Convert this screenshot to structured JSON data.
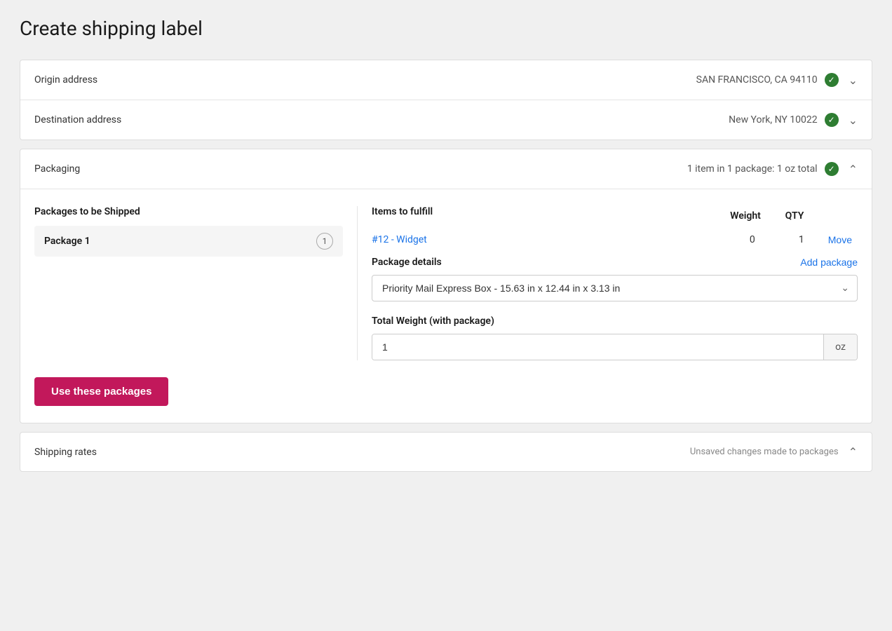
{
  "page": {
    "title": "Create shipping label"
  },
  "origin": {
    "label": "Origin address",
    "value": "SAN FRANCISCO, CA  94110",
    "verified": true
  },
  "destination": {
    "label": "Destination address",
    "value": "New York, NY  10022",
    "verified": true
  },
  "packaging": {
    "label": "Packaging",
    "summary": "1 item in 1 package: 1 oz total",
    "verified": true,
    "columns": {
      "packages": "Packages to be Shipped",
      "items": "Items to fulfill",
      "weight": "Weight",
      "qty": "QTY"
    },
    "package": {
      "name": "Package 1",
      "badge": "1"
    },
    "item": {
      "link": "#12 - Widget",
      "weight": "0",
      "qty": "1",
      "move_label": "Move"
    },
    "details": {
      "label": "Package details",
      "add_label": "Add package",
      "select_value": "Priority Mail Express Box - 15.63 in x 12.44 in x 3.13 in"
    },
    "total_weight": {
      "label": "Total Weight (with package)",
      "value": "1",
      "unit": "oz"
    },
    "use_packages_button": "Use these packages"
  },
  "shipping_rates": {
    "label": "Shipping rates",
    "unsaved": "Unsaved changes made to packages"
  }
}
